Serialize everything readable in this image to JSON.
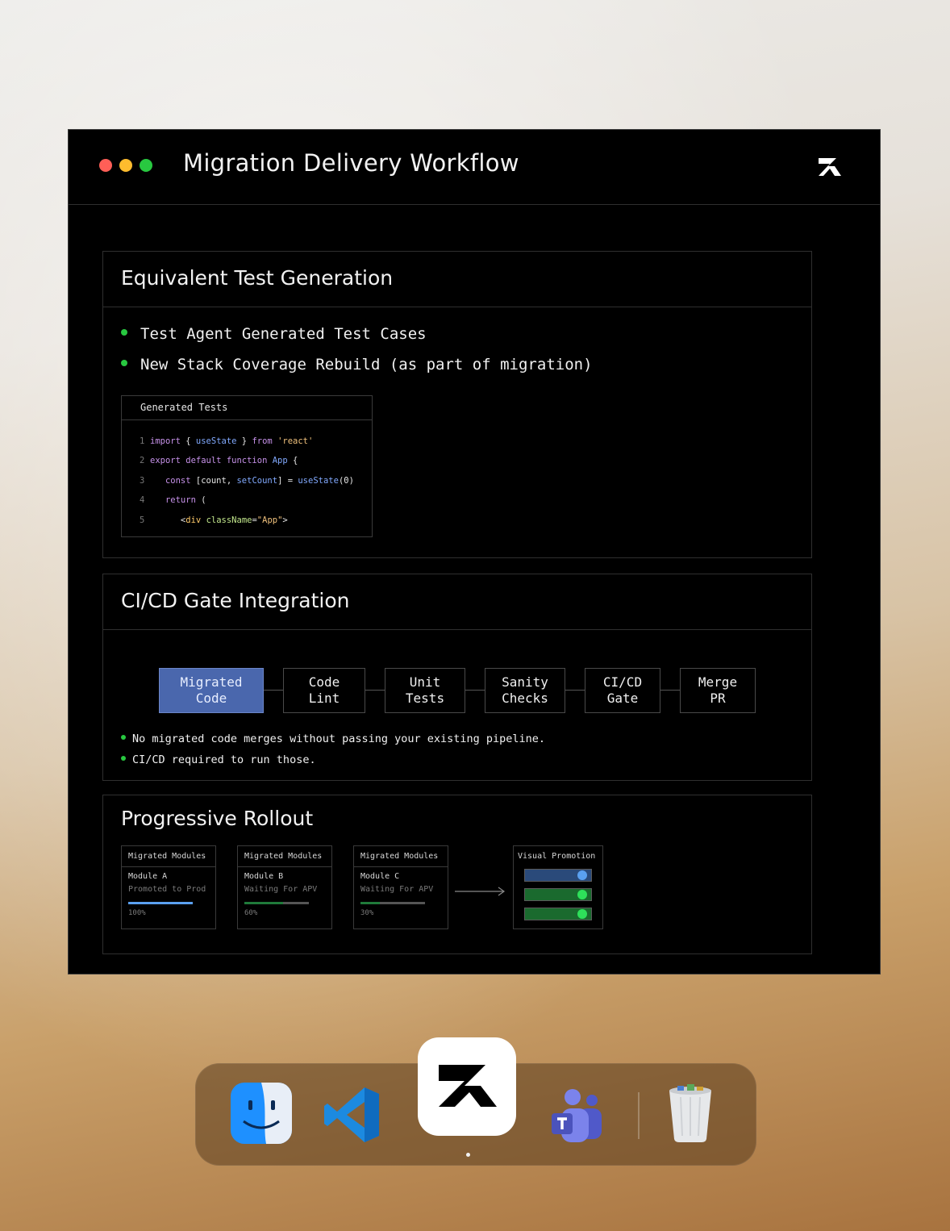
{
  "window": {
    "title": "Migration Delivery Workflow",
    "logo_icon": "zr-logo-icon"
  },
  "sections": {
    "tests": {
      "title": "Equivalent Test Generation",
      "bullets": [
        "Test Agent Generated Test Cases",
        "New Stack Coverage Rebuild (as part of migration)"
      ],
      "code": {
        "header": "Generated Tests",
        "line_numbers": [
          "1",
          "2",
          "3",
          "4",
          "5"
        ]
      }
    },
    "cicd": {
      "title": "CI/CD Gate Integration",
      "steps": [
        {
          "line1": "Migrated",
          "line2": "Code"
        },
        {
          "line1": "Code",
          "line2": "Lint"
        },
        {
          "line1": "Unit",
          "line2": "Tests"
        },
        {
          "line1": "Sanity",
          "line2": "Checks"
        },
        {
          "line1": "CI/CD",
          "line2": "Gate"
        },
        {
          "line1": "Merge",
          "line2": "PR"
        }
      ],
      "notes": [
        "No migrated code merges without passing your existing pipeline.",
        "CI/CD required to run those."
      ]
    },
    "rollout": {
      "title": "Progressive Rollout",
      "modules": [
        {
          "header": "Migrated Modules",
          "name": "Module A",
          "status": "Promoted to Prod",
          "progress": 1.0,
          "pct": "100%",
          "color": "#5aa0f0"
        },
        {
          "header": "Migrated Modules",
          "name": "Module B",
          "status": "Waiting For APV",
          "progress": 0.6,
          "pct": "60%",
          "color": "#1f7a3a"
        },
        {
          "header": "Migrated Modules",
          "name": "Module C",
          "status": "Waiting For APV",
          "progress": 0.3,
          "pct": "30%",
          "color": "#1f7a3a"
        }
      ],
      "promotion": {
        "header": "Visual Promotion",
        "toggles": [
          {
            "state": "on",
            "color": "#2a4a7a",
            "knob": "#5aa0f0"
          },
          {
            "state": "on",
            "color": "#1a6a2e",
            "knob": "#2ee05a"
          },
          {
            "state": "on",
            "color": "#1a6a2e",
            "knob": "#2ee05a"
          }
        ]
      }
    }
  },
  "dock": {
    "apps": [
      "finder-icon",
      "vscode-icon",
      "zr-app-icon",
      "teams-icon",
      "trash-icon"
    ]
  },
  "colors": {
    "accent_blue": "#4a67ad",
    "bullet_green": "#28c840"
  }
}
